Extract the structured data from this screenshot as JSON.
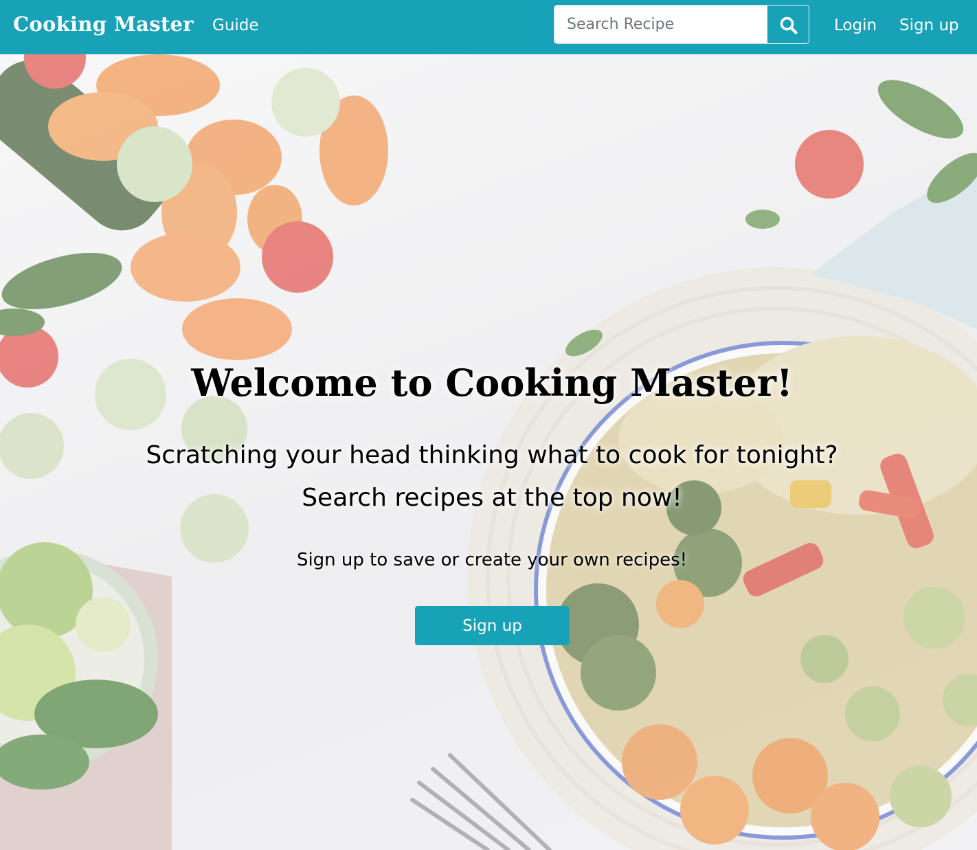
{
  "navbar": {
    "brand": "Cooking Master",
    "guide_label": "Guide",
    "search": {
      "placeholder": "Search Recipe"
    },
    "search_icon": "search-icon",
    "login_label": "Login",
    "signup_label": "Sign up"
  },
  "hero": {
    "title": "Welcome to Cooking Master!",
    "subtitle_line1": "Scratching your head thinking what to cook for tonight?",
    "subtitle_line2": "Search recipes at the top now!",
    "note": "Sign up to save or create your own recipes!",
    "button_label": "Sign up"
  },
  "colors": {
    "accent": "#17a2b8",
    "text": "#000000",
    "white": "#ffffff"
  }
}
